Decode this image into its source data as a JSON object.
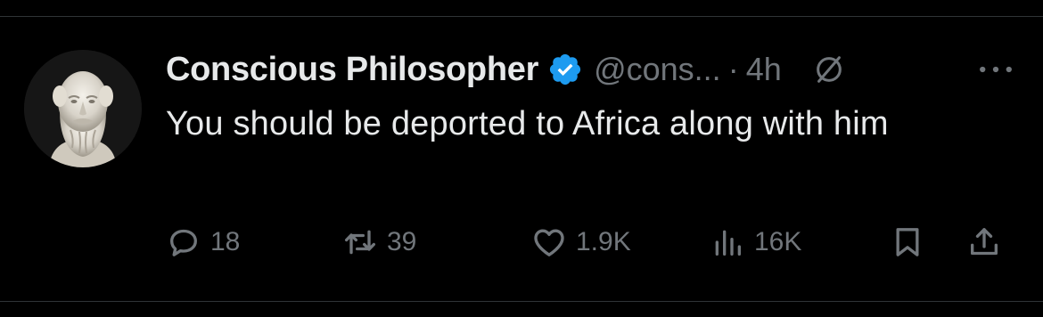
{
  "tweet": {
    "author": {
      "display_name": "Conscious Philosopher",
      "handle": "@cons...",
      "verified": true,
      "avatar_description": "marble-bust-avatar"
    },
    "separator": "·",
    "time": "4h",
    "text": "You should be deported to Africa along with him",
    "actions": {
      "reply_count": "18",
      "repost_count": "39",
      "like_count": "1.9K",
      "view_count": "16K"
    }
  },
  "icons": {
    "verified": "verified-badge-icon",
    "grok": "grok-icon",
    "more": "more-options-icon",
    "reply": "reply-icon",
    "repost": "repost-icon",
    "like": "heart-icon",
    "views": "views-chart-icon",
    "bookmark": "bookmark-icon",
    "share": "share-icon"
  },
  "colors": {
    "background": "#000000",
    "text_primary": "#e7e9ea",
    "text_secondary": "#71767b",
    "verified_blue": "#1d9bf0",
    "divider": "#2f3336"
  }
}
